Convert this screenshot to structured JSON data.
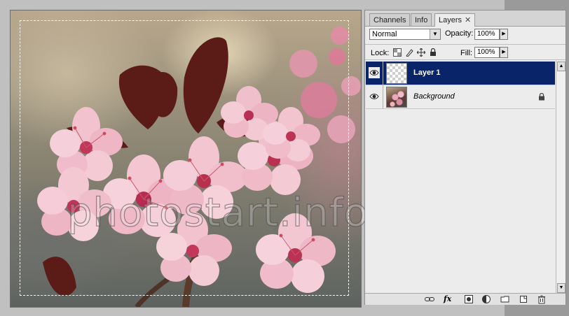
{
  "watermark": "photostart.info",
  "panel": {
    "tabs": [
      {
        "label": "Channels",
        "active": false
      },
      {
        "label": "Info",
        "active": false
      },
      {
        "label": "Layers",
        "active": true
      }
    ],
    "close_glyph": "✕",
    "blend_mode": "Normal",
    "opacity_label": "Opacity:",
    "opacity_value": "100%",
    "lock_label": "Lock:",
    "fill_label": "Fill:",
    "fill_value": "100%",
    "lock_icons": [
      "lock-transparent-pixels-icon",
      "lock-image-pixels-icon",
      "lock-position-icon",
      "lock-all-icon"
    ],
    "layers": [
      {
        "name": "Layer 1",
        "selected": true,
        "visible": true,
        "thumbnail": "transparent",
        "locked": false
      },
      {
        "name": "Background",
        "selected": false,
        "visible": true,
        "thumbnail": "photo",
        "locked": true
      }
    ],
    "bottom_icons": [
      "link-layers-icon",
      "fx-icon",
      "layer-mask-icon",
      "adjustment-layer-icon",
      "new-group-icon",
      "new-layer-icon",
      "delete-layer-icon"
    ],
    "fx_label": "fx",
    "selection_color": "#0a246a"
  }
}
